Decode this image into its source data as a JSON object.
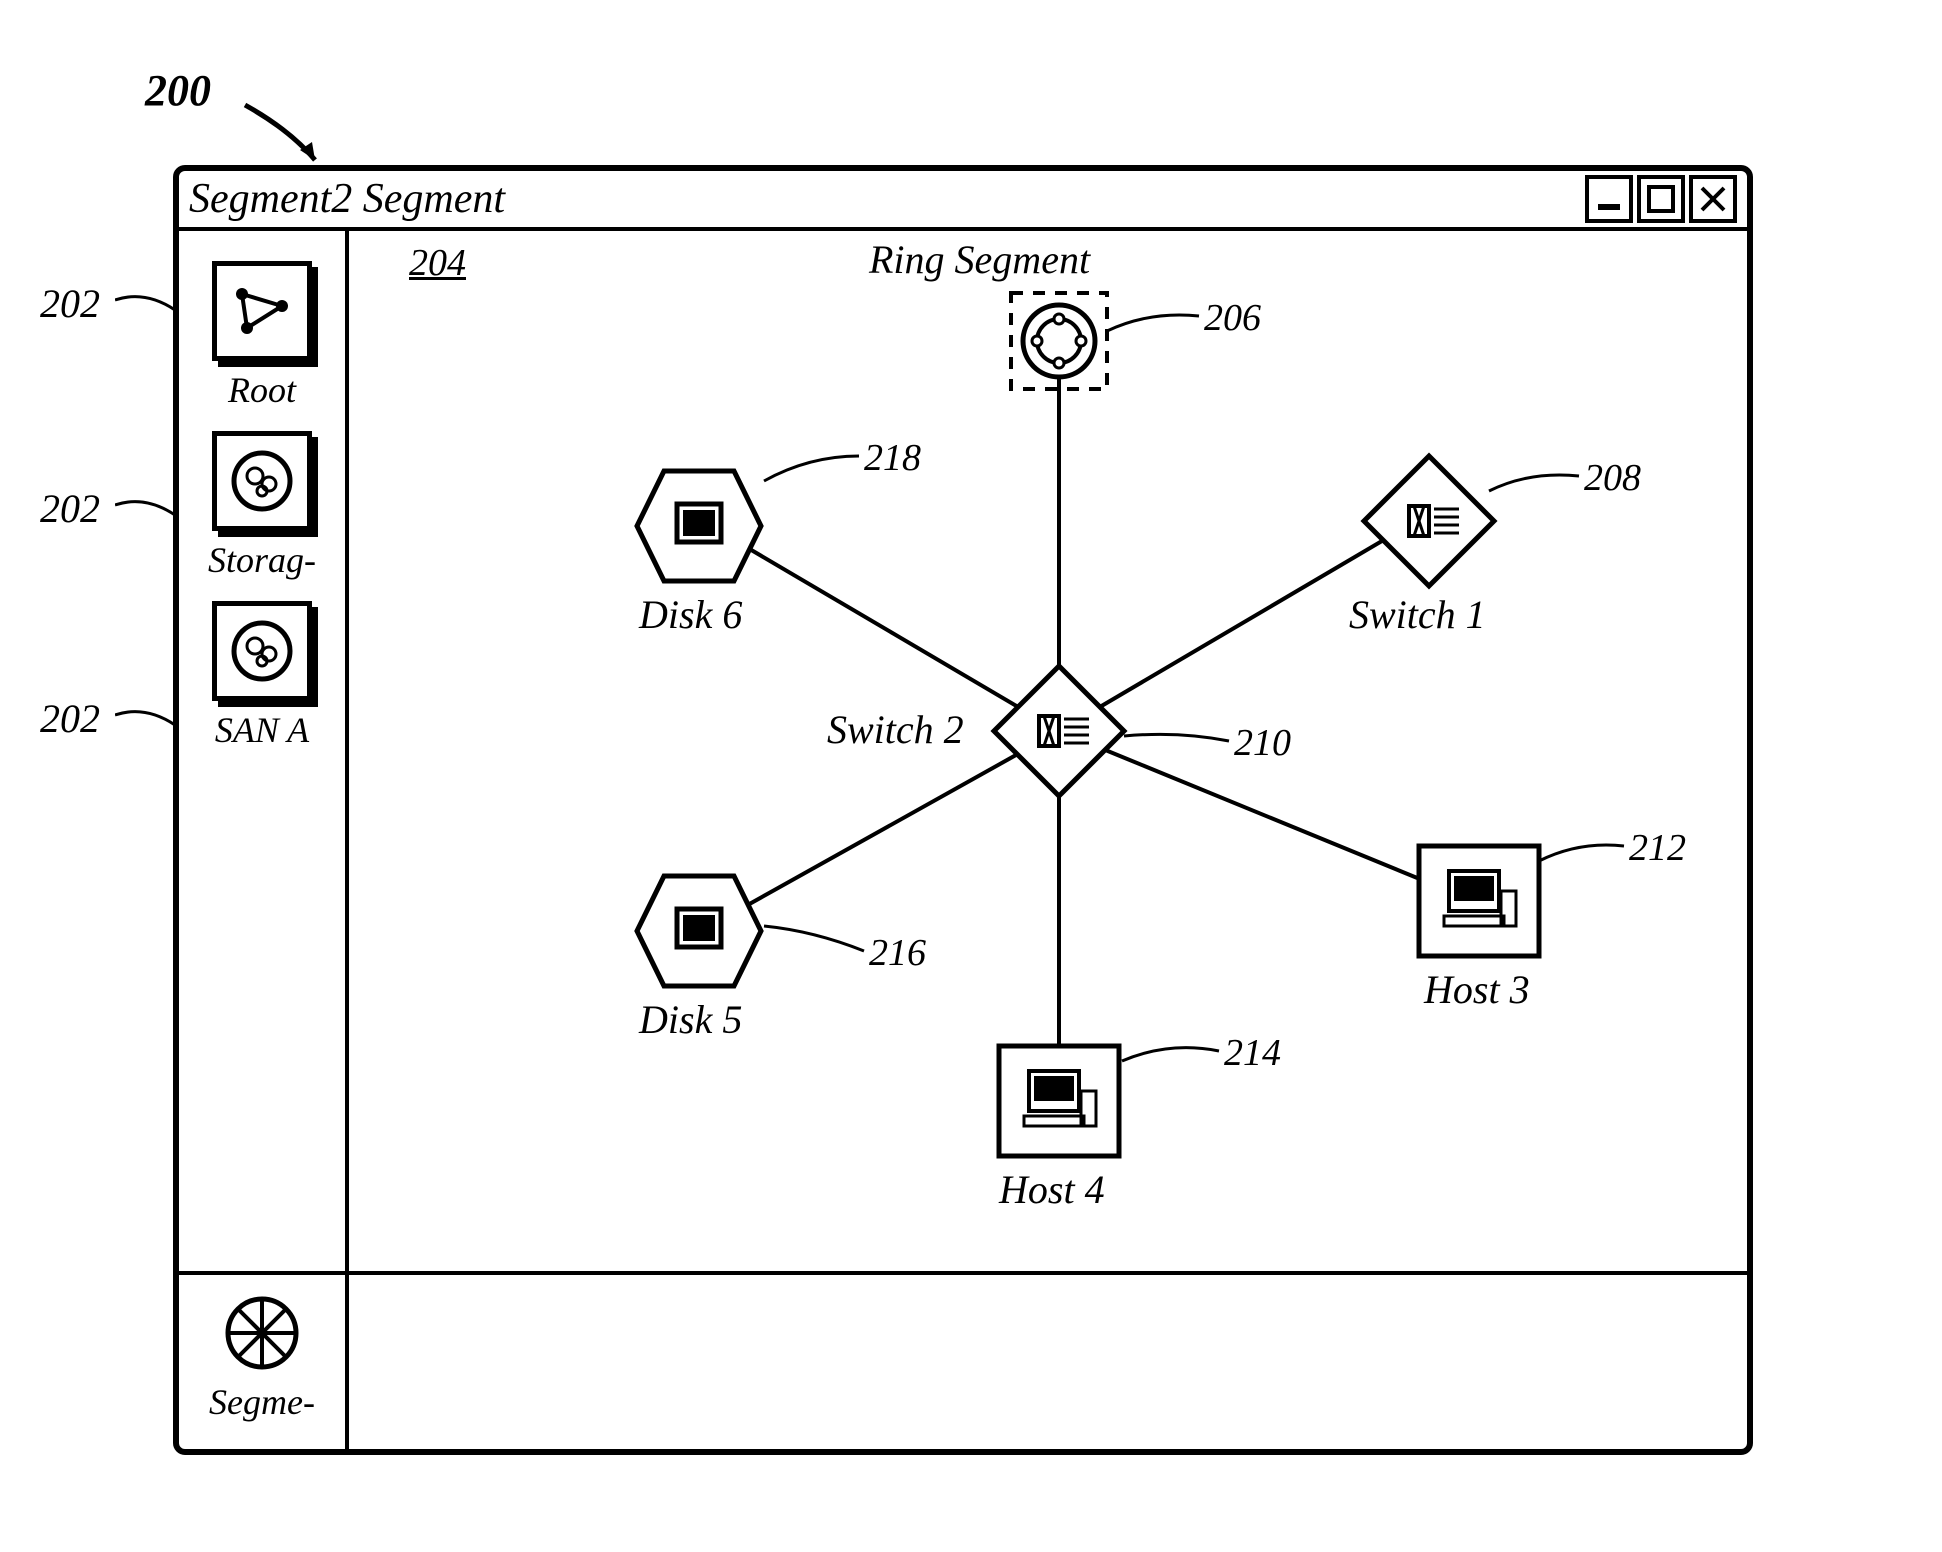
{
  "figure_number": "200",
  "window": {
    "title": "Segment2 Segment"
  },
  "sidebar": {
    "items": [
      {
        "label": "Root",
        "ref": "202"
      },
      {
        "label": "Storag-",
        "ref": "202"
      },
      {
        "label": "SAN A",
        "ref": "202"
      }
    ]
  },
  "canvas": {
    "ref": "204",
    "title": "Ring Segment",
    "nodes": {
      "ring_segment": {
        "label": "Ring Segment",
        "ref": "206"
      },
      "switch1": {
        "label": "Switch 1",
        "ref": "208"
      },
      "switch2": {
        "label": "Switch 2",
        "ref": "210"
      },
      "host3": {
        "label": "Host 3",
        "ref": "212"
      },
      "host4": {
        "label": "Host 4",
        "ref": "214"
      },
      "disk5": {
        "label": "Disk 5",
        "ref": "216"
      },
      "disk6": {
        "label": "Disk 6",
        "ref": "218"
      }
    }
  },
  "bottom": {
    "label": "Segme-"
  }
}
